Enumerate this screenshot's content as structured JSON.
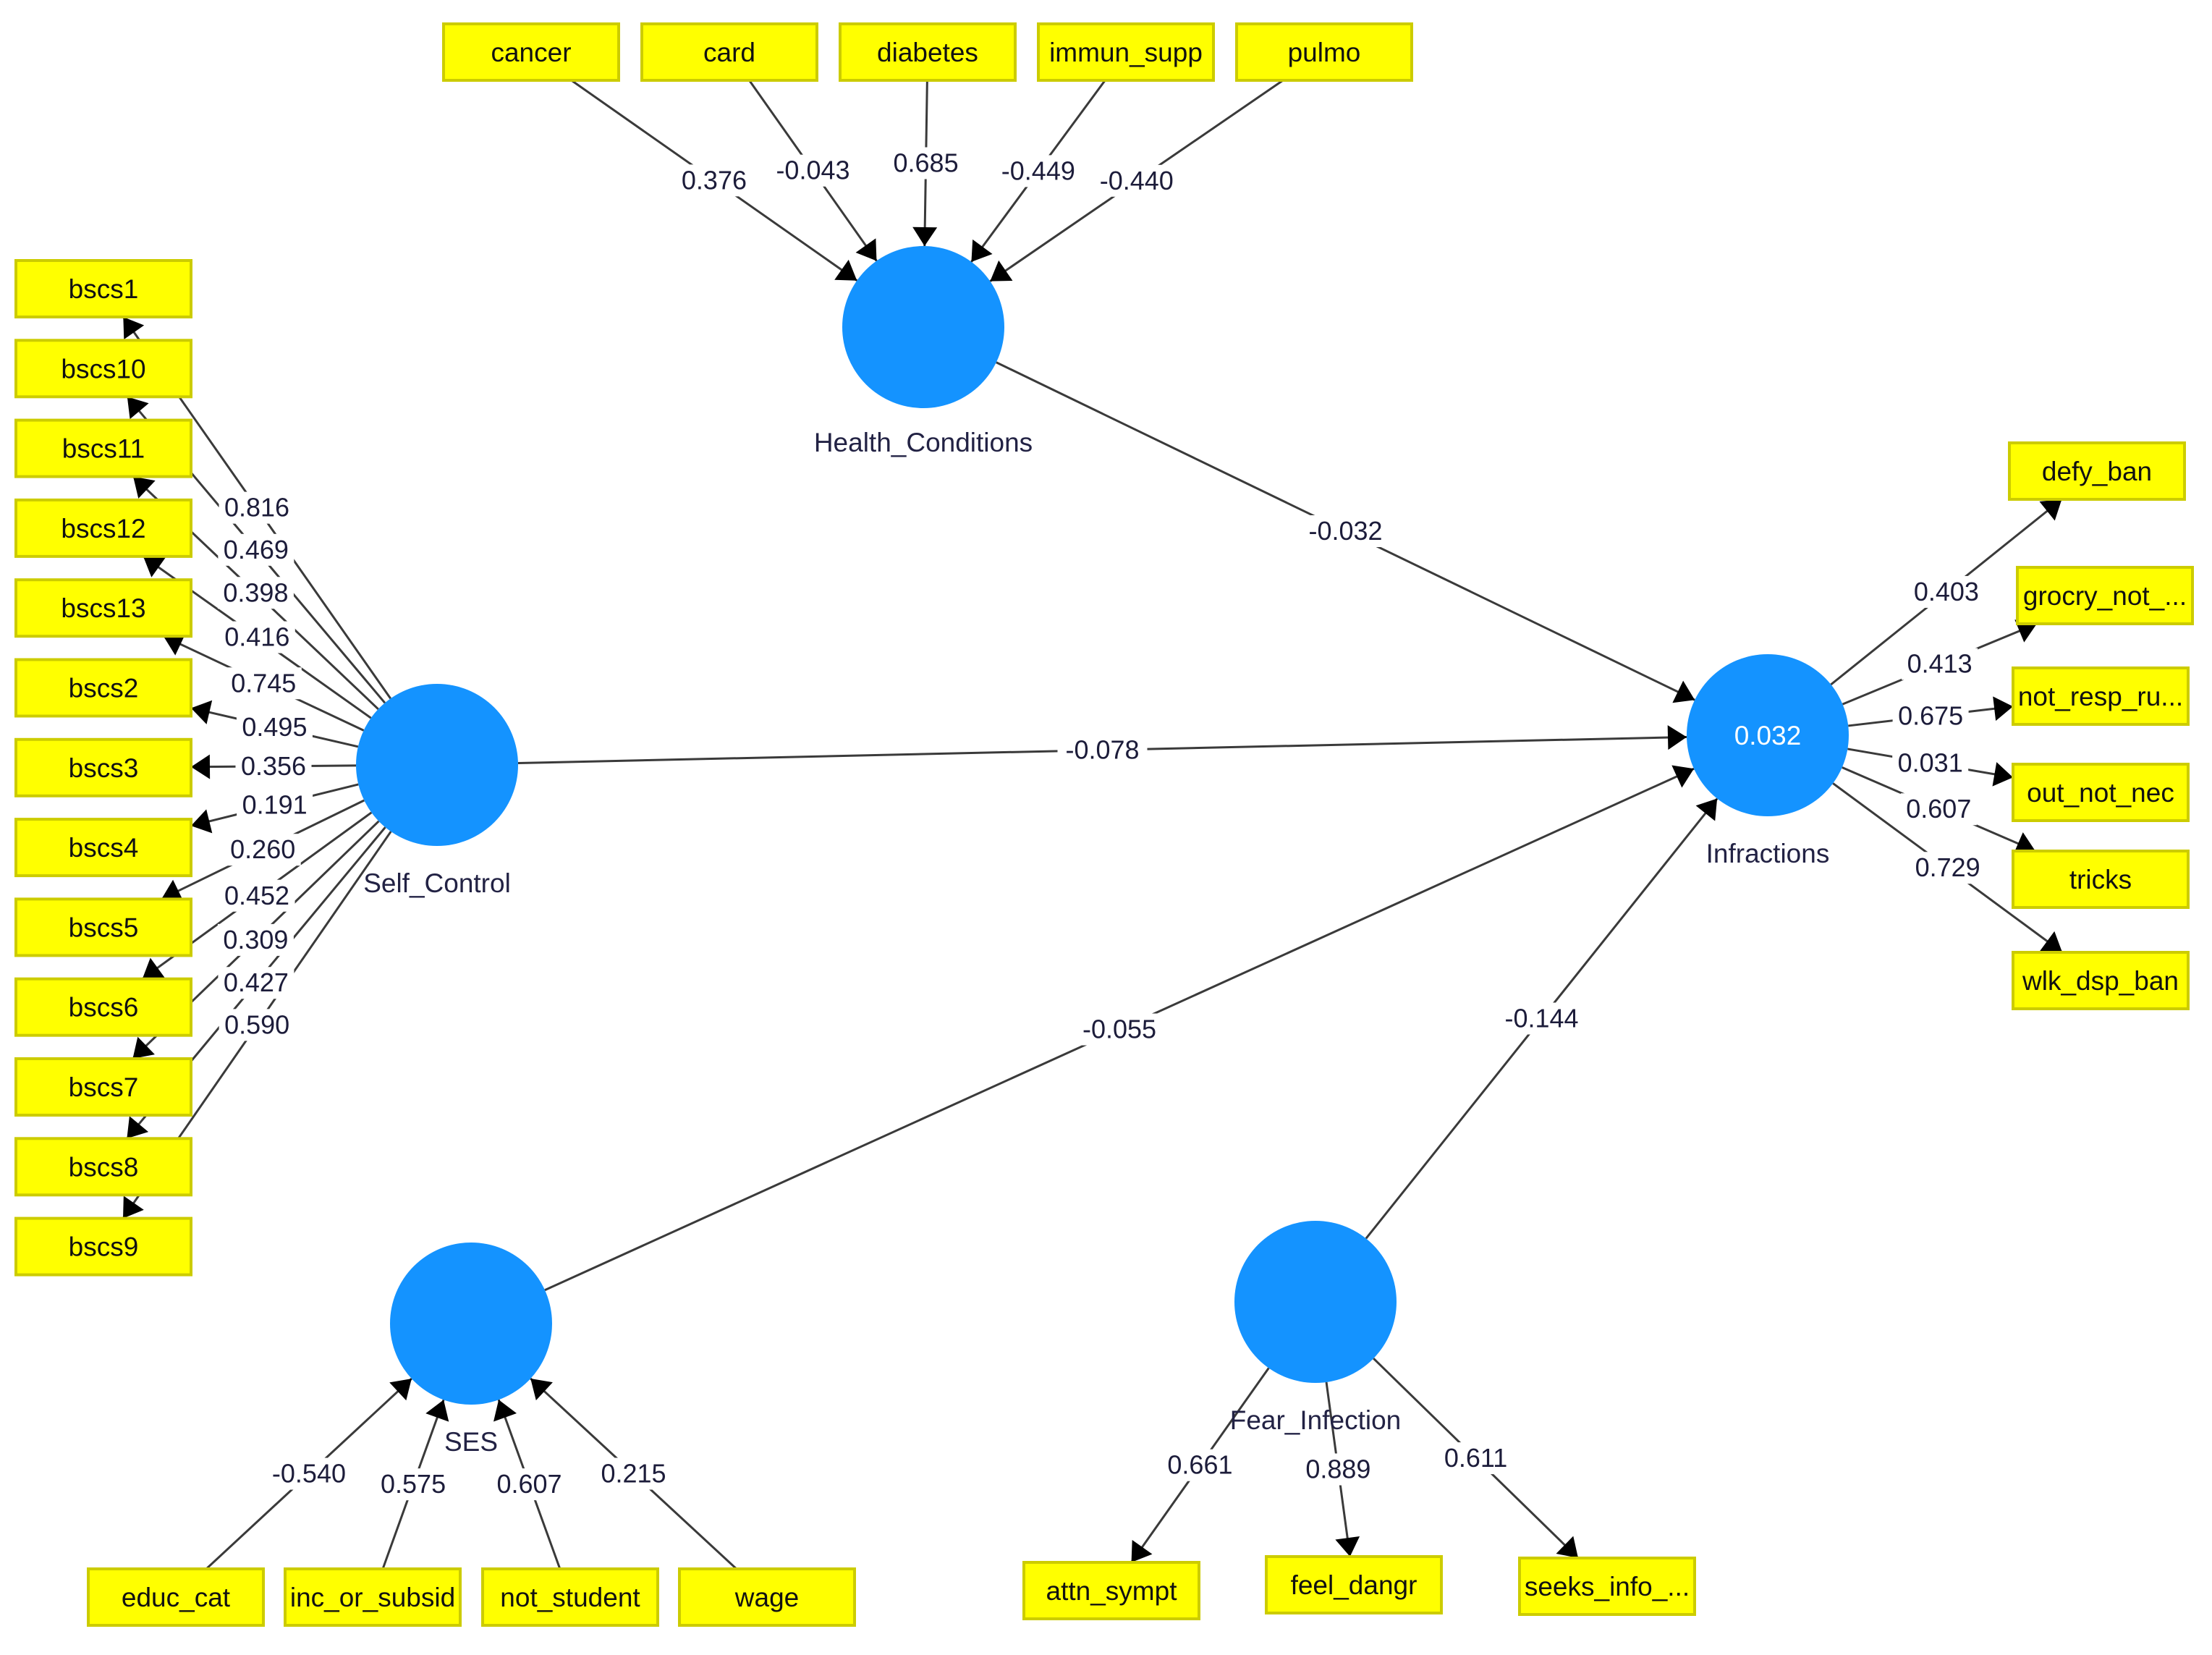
{
  "diagram": {
    "type": "PLS-SEM path model",
    "colors": {
      "construct_fill": "#1493FF",
      "indicator_fill": "#FFFF00",
      "indicator_border": "#CCCC00",
      "edge": "#3A3A3A"
    },
    "constructs": [
      {
        "id": "health",
        "name": "Health_Conditions",
        "value": null
      },
      {
        "id": "self",
        "name": "Self_Control",
        "value": null
      },
      {
        "id": "infr",
        "name": "Infractions",
        "value": "0.032"
      },
      {
        "id": "ses",
        "name": "SES",
        "value": null
      },
      {
        "id": "fear",
        "name": "Fear_Infection",
        "value": null
      }
    ],
    "indicators": [
      {
        "id": "cancer",
        "label": "cancer",
        "construct": "health",
        "weight": "0.376",
        "direction": "to_construct"
      },
      {
        "id": "card",
        "label": "card",
        "construct": "health",
        "weight": "-0.043",
        "direction": "to_construct"
      },
      {
        "id": "diabetes",
        "label": "diabetes",
        "construct": "health",
        "weight": "0.685",
        "direction": "to_construct"
      },
      {
        "id": "immun_supp",
        "label": "immun_supp",
        "construct": "health",
        "weight": "-0.449",
        "direction": "to_construct"
      },
      {
        "id": "pulmo",
        "label": "pulmo",
        "construct": "health",
        "weight": "-0.440",
        "direction": "to_construct"
      },
      {
        "id": "bscs1",
        "label": "bscs1",
        "construct": "self",
        "weight": "0.816",
        "direction": "to_indicator"
      },
      {
        "id": "bscs10",
        "label": "bscs10",
        "construct": "self",
        "weight": "0.469",
        "direction": "to_indicator"
      },
      {
        "id": "bscs11",
        "label": "bscs11",
        "construct": "self",
        "weight": "0.398",
        "direction": "to_indicator"
      },
      {
        "id": "bscs12",
        "label": "bscs12",
        "construct": "self",
        "weight": "0.416",
        "direction": "to_indicator"
      },
      {
        "id": "bscs13",
        "label": "bscs13",
        "construct": "self",
        "weight": "0.745",
        "direction": "to_indicator"
      },
      {
        "id": "bscs2",
        "label": "bscs2",
        "construct": "self",
        "weight": "0.495",
        "direction": "to_indicator"
      },
      {
        "id": "bscs3",
        "label": "bscs3",
        "construct": "self",
        "weight": "0.356",
        "direction": "to_indicator"
      },
      {
        "id": "bscs4",
        "label": "bscs4",
        "construct": "self",
        "weight": "0.191",
        "direction": "to_indicator"
      },
      {
        "id": "bscs5",
        "label": "bscs5",
        "construct": "self",
        "weight": "0.260",
        "direction": "to_indicator"
      },
      {
        "id": "bscs6",
        "label": "bscs6",
        "construct": "self",
        "weight": "0.452",
        "direction": "to_indicator"
      },
      {
        "id": "bscs7",
        "label": "bscs7",
        "construct": "self",
        "weight": "0.309",
        "direction": "to_indicator"
      },
      {
        "id": "bscs8",
        "label": "bscs8",
        "construct": "self",
        "weight": "0.427",
        "direction": "to_indicator"
      },
      {
        "id": "bscs9",
        "label": "bscs9",
        "construct": "self",
        "weight": "0.590",
        "direction": "to_indicator"
      },
      {
        "id": "defy_ban",
        "label": "defy_ban",
        "construct": "infr",
        "weight": "0.403",
        "direction": "to_indicator"
      },
      {
        "id": "grocry_not",
        "label": "grocry_not_...",
        "construct": "infr",
        "weight": "0.413",
        "direction": "to_indicator"
      },
      {
        "id": "not_resp_ru",
        "label": "not_resp_ru...",
        "construct": "infr",
        "weight": "0.675",
        "direction": "to_indicator"
      },
      {
        "id": "out_not_nec",
        "label": "out_not_nec",
        "construct": "infr",
        "weight": "0.031",
        "direction": "to_indicator"
      },
      {
        "id": "tricks",
        "label": "tricks",
        "construct": "infr",
        "weight": "0.607",
        "direction": "to_indicator"
      },
      {
        "id": "wlk_dsp_ban",
        "label": "wlk_dsp_ban",
        "construct": "infr",
        "weight": "0.729",
        "direction": "to_indicator"
      },
      {
        "id": "educ_cat",
        "label": "educ_cat",
        "construct": "ses",
        "weight": "-0.540",
        "direction": "to_construct"
      },
      {
        "id": "inc_or_subsid",
        "label": "inc_or_subsid",
        "construct": "ses",
        "weight": "0.575",
        "direction": "to_construct"
      },
      {
        "id": "not_student",
        "label": "not_student",
        "construct": "ses",
        "weight": "0.607",
        "direction": "to_construct"
      },
      {
        "id": "wage",
        "label": "wage",
        "construct": "ses",
        "weight": "0.215",
        "direction": "to_construct"
      },
      {
        "id": "attn_sympt",
        "label": "attn_sympt",
        "construct": "fear",
        "weight": "0.661",
        "direction": "to_indicator"
      },
      {
        "id": "feel_dangr",
        "label": "feel_dangr",
        "construct": "fear",
        "weight": "0.889",
        "direction": "to_indicator"
      },
      {
        "id": "seeks_info",
        "label": "seeks_info_...",
        "construct": "fear",
        "weight": "0.611",
        "direction": "to_indicator"
      }
    ],
    "paths": [
      {
        "from": "health",
        "to": "infr",
        "coefficient": "-0.032"
      },
      {
        "from": "self",
        "to": "infr",
        "coefficient": "-0.078"
      },
      {
        "from": "ses",
        "to": "infr",
        "coefficient": "-0.055"
      },
      {
        "from": "fear",
        "to": "infr",
        "coefficient": "-0.144"
      }
    ]
  }
}
